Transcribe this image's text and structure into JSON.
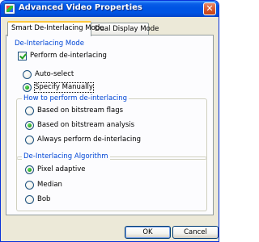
{
  "window": {
    "title": "Advanced Video Properties",
    "close_glyph": "✕",
    "app_icon": "video-properties-icon"
  },
  "tabs": [
    {
      "label": "Smart De-Interlacing Mode",
      "active": true
    },
    {
      "label": "Dual Display Mode",
      "active": false
    }
  ],
  "deinterlacing_mode": {
    "title": "De-Interlacing Mode",
    "perform_label": "Perform de-interlacing",
    "perform_checked": true,
    "auto_label": "Auto-select",
    "manual_label": "Specify Manually",
    "selected": "Specify Manually"
  },
  "how_to_perform": {
    "title": "How to perform de-interlacing",
    "options": [
      "Based on bitstream flags",
      "Based on bitstream analysis",
      "Always perform de-interlacing"
    ],
    "selected": "Based on bitstream analysis"
  },
  "algorithm": {
    "title": "De-Interlacing Algorithm",
    "options": [
      "Pixel adaptive",
      "Median",
      "Bob"
    ],
    "selected": "Pixel adaptive"
  },
  "buttons": {
    "ok_label": "OK",
    "cancel_label": "Cancel"
  },
  "colors": {
    "title_bar": "#0054e3",
    "group_label": "#0046d5",
    "dialog_background": "#ece9d8",
    "radio_selected": "#21a121"
  }
}
